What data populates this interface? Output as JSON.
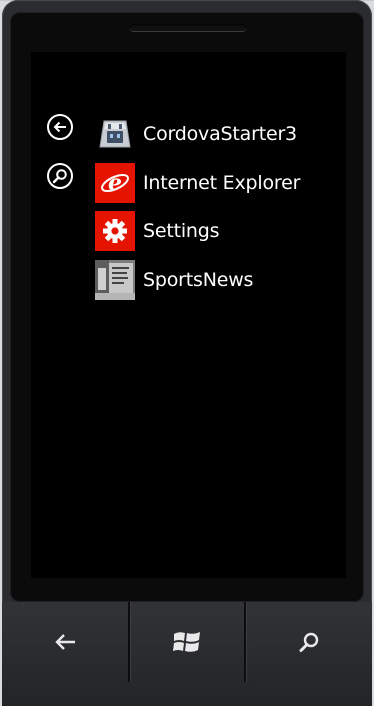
{
  "apps": [
    {
      "name": "CordovaStarter3",
      "icon": "cordova-icon",
      "tile_color": "#cfd3d8"
    },
    {
      "name": "Internet Explorer",
      "icon": "internet-explorer-icon",
      "tile_color": "#e51400"
    },
    {
      "name": "Settings",
      "icon": "settings-gear-icon",
      "tile_color": "#e51400"
    },
    {
      "name": "SportsNews",
      "icon": "sportsnews-photo-icon",
      "tile_color": "#9a9a9a"
    }
  ],
  "side_buttons": [
    {
      "icon": "back-arrow-icon"
    },
    {
      "icon": "search-icon"
    }
  ],
  "hardware_buttons": [
    {
      "icon": "back-arrow-icon"
    },
    {
      "icon": "windows-logo-icon"
    },
    {
      "icon": "search-icon"
    }
  ],
  "colors": {
    "accent": "#e51400",
    "screen_background": "#000000",
    "text": "#ffffff",
    "phone_body": "#2a2c2f"
  }
}
